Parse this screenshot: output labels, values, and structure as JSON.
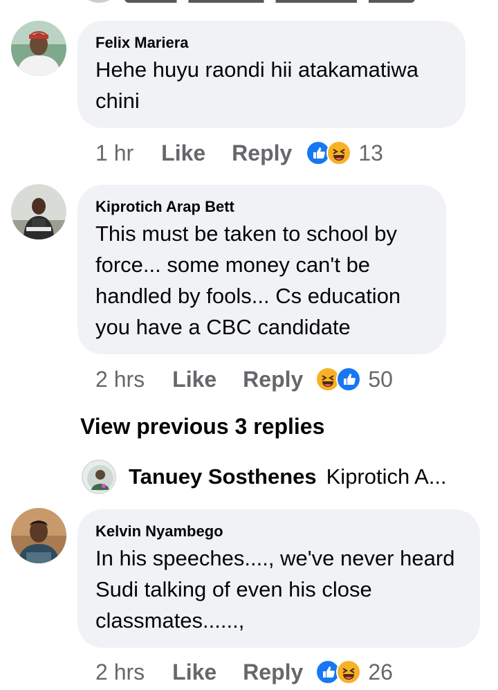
{
  "comments": [
    {
      "author": "Felix Mariera",
      "text": "Hehe huyu raondi hii atakamatiwa chini",
      "time": "1 hr",
      "like_label": "Like",
      "reply_label": "Reply",
      "reactions": [
        "like-icon",
        "haha-icon"
      ],
      "reaction_count": "13"
    },
    {
      "author": "Kiprotich Arap Bett",
      "text": "This must be taken to school by force... some money can't be handled by fools... Cs education you have a CBC candidate",
      "time": "2 hrs",
      "like_label": "Like",
      "reply_label": "Reply",
      "reactions": [
        "haha-icon",
        "like-icon"
      ],
      "reaction_count": "50"
    },
    {
      "author": "Kelvin Nyambego",
      "text": "In his speeches...., we've never heard Sudi talking of even his close classmates......,",
      "time": "2 hrs",
      "like_label": "Like",
      "reply_label": "Reply",
      "reactions": [
        "like-icon",
        "haha-icon"
      ],
      "reaction_count": "26"
    }
  ],
  "view_previous": "View previous 3 replies",
  "reply_preview": {
    "author": "Tanuey Sosthenes",
    "snippet": "Kiprotich A..."
  },
  "colors": {
    "bubble": "#f0f2f5",
    "meta": "#65676b",
    "like": "#1877f2",
    "haha": "#f7b125"
  }
}
